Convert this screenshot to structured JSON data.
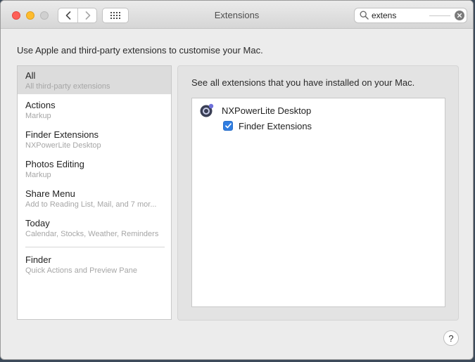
{
  "window": {
    "title": "Extensions"
  },
  "search": {
    "value": "extens"
  },
  "intro": "Use Apple and third-party extensions to customise your Mac.",
  "sidebar": {
    "items": [
      {
        "title": "All",
        "subtitle": "All third-party extensions",
        "selected": true
      },
      {
        "title": "Actions",
        "subtitle": "Markup"
      },
      {
        "title": "Finder Extensions",
        "subtitle": "NXPowerLite Desktop"
      },
      {
        "title": "Photos Editing",
        "subtitle": "Markup"
      },
      {
        "title": "Share Menu",
        "subtitle": "Add to Reading List, Mail, and 7 mor..."
      },
      {
        "title": "Today",
        "subtitle": "Calendar, Stocks, Weather, Reminders"
      },
      {
        "title": "Finder",
        "subtitle": "Quick Actions and Preview Pane"
      }
    ]
  },
  "panel": {
    "description": "See all extensions that you have installed on your Mac.",
    "apps": [
      {
        "name": "NXPowerLite Desktop",
        "icon": "nxpowerlite-app-icon",
        "extensions": [
          {
            "label": "Finder Extensions",
            "checked": true
          }
        ]
      }
    ]
  },
  "help_label": "?",
  "colors": {
    "accent": "#2f7de1",
    "selected_row": "#dcdcdc",
    "close": "#fe5f57",
    "minimize": "#febc2e"
  }
}
